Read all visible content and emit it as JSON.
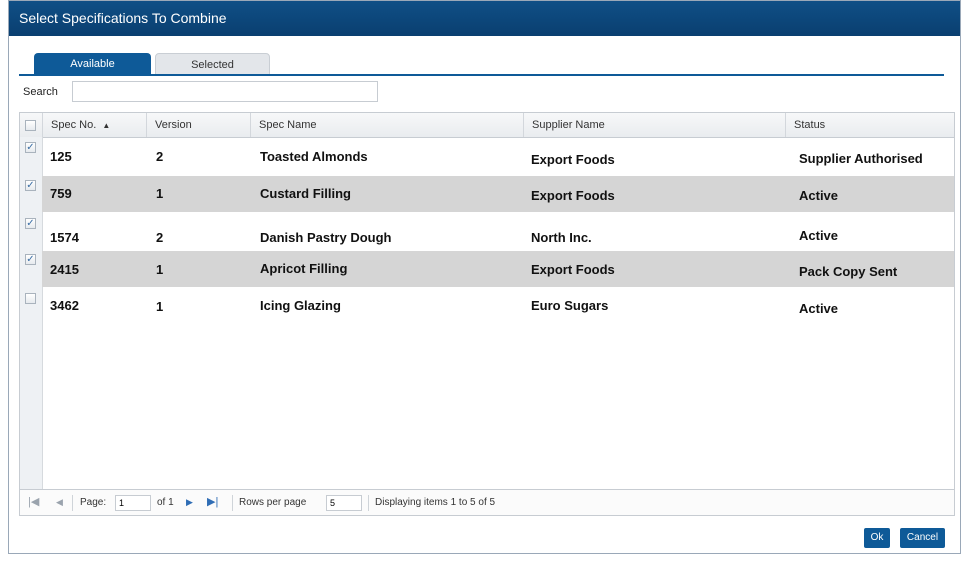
{
  "dialog": {
    "title": "Select Specifications To Combine"
  },
  "tabs": [
    {
      "label": "Available",
      "active": true
    },
    {
      "label": "Selected",
      "active": false
    }
  ],
  "search": {
    "label": "Search",
    "value": ""
  },
  "table": {
    "columns": [
      "Spec No.",
      "Version",
      "Spec Name",
      "Supplier Name",
      "Status"
    ],
    "sort_indicator": "▲",
    "rows": [
      {
        "checked": true,
        "spec_no": "125",
        "version": "2",
        "spec_name": "Toasted Almonds",
        "supplier": "Export Foods",
        "status": "Supplier Authorised"
      },
      {
        "checked": true,
        "spec_no": "759",
        "version": "1",
        "spec_name": "Custard Filling",
        "supplier": "Export Foods",
        "status": "Active"
      },
      {
        "checked": true,
        "spec_no": "1574",
        "version": "2",
        "spec_name": "Danish Pastry Dough",
        "supplier": "North Inc.",
        "status": "Active"
      },
      {
        "checked": true,
        "spec_no": "2415",
        "version": "1",
        "spec_name": "Apricot Filling",
        "supplier": "Export Foods",
        "status": "Pack Copy Sent"
      },
      {
        "checked": false,
        "spec_no": "3462",
        "version": "1",
        "spec_name": "Icing Glazing",
        "supplier": "Euro Sugars",
        "status": "Active"
      }
    ]
  },
  "pager": {
    "page_label": "Page:",
    "page_value": "1",
    "of_label": "of 1",
    "rows_label": "Rows per page",
    "rows_value": "5",
    "display_text": "Displaying items 1 to 5 of  5"
  },
  "buttons": {
    "ok": "Ok",
    "cancel": "Cancel"
  },
  "colors": {
    "titlebar": "#0a3f70",
    "accent": "#0e5a98",
    "row_shade": "#d5d5d5"
  }
}
